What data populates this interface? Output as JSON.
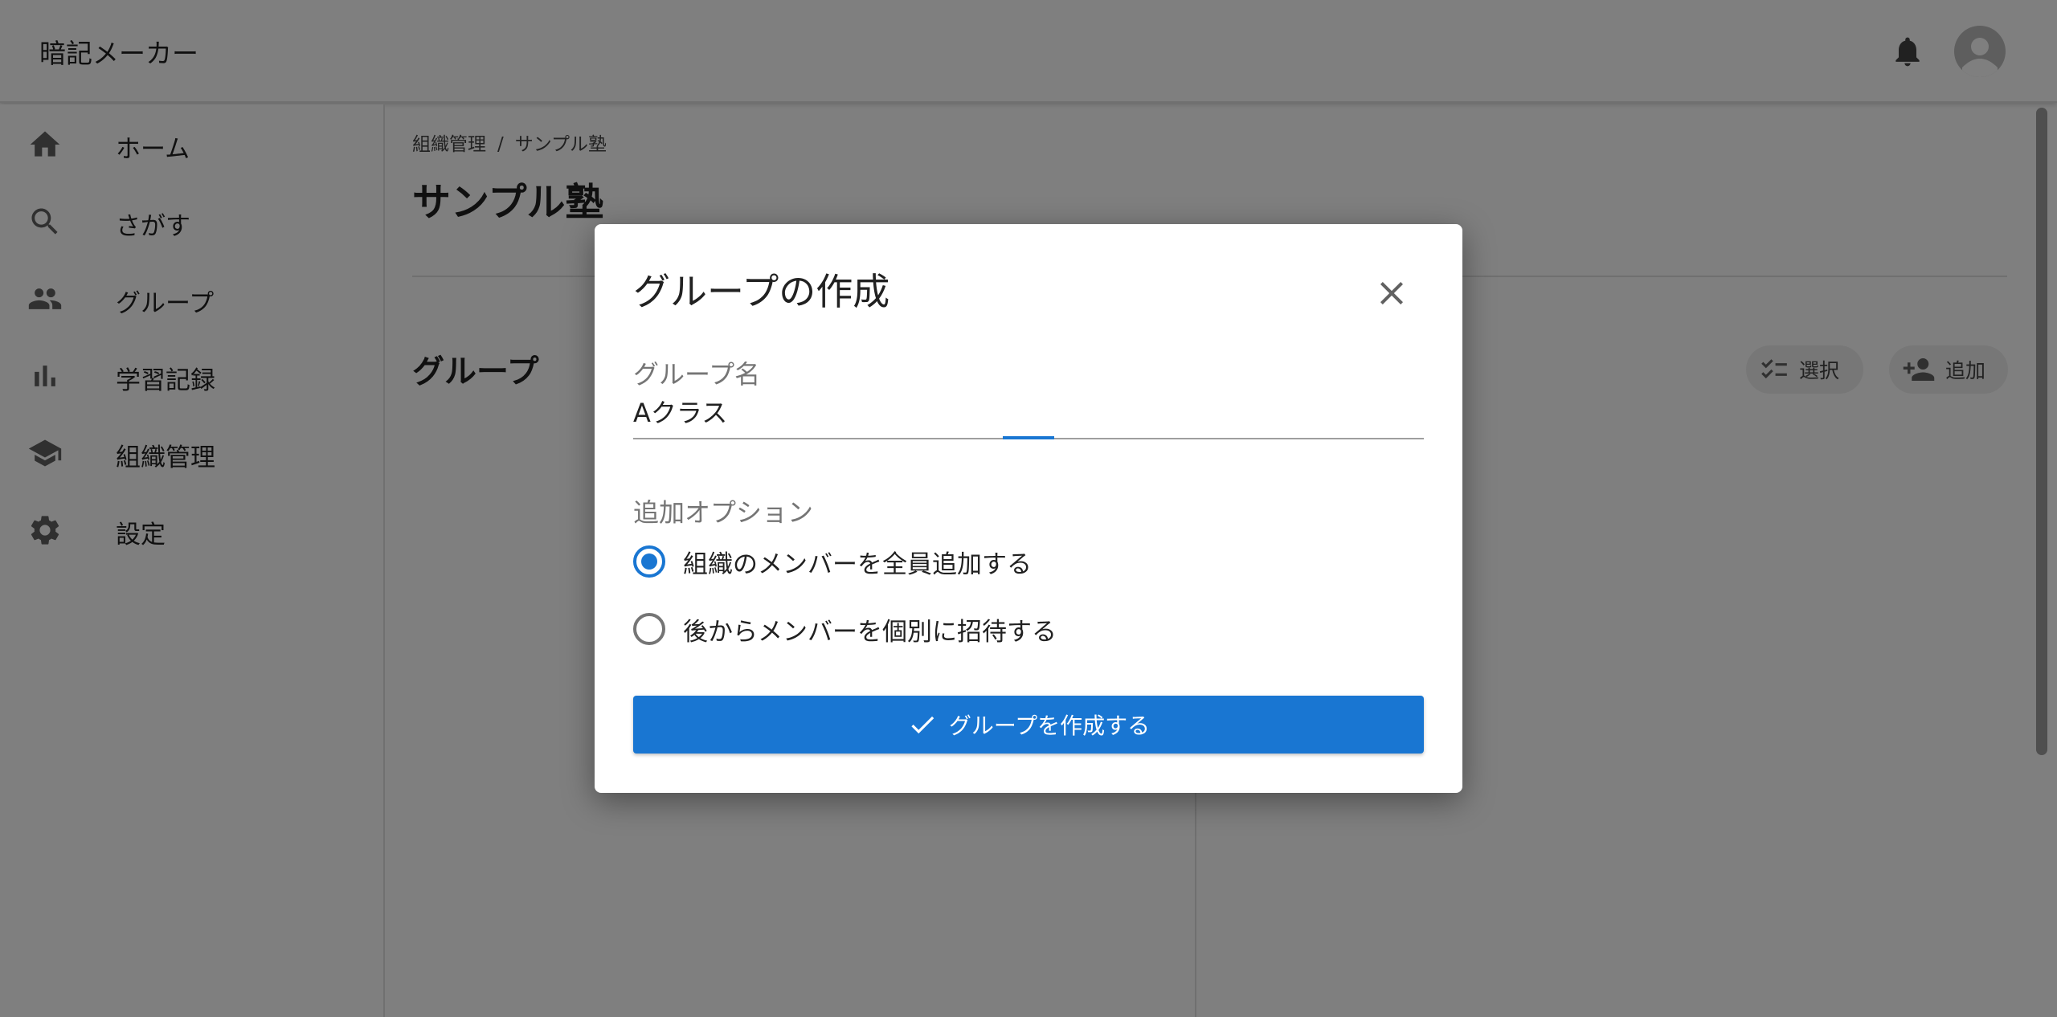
{
  "header": {
    "app_title": "暗記メーカー",
    "icons": [
      "bell-icon",
      "account-icon"
    ]
  },
  "sidebar": {
    "items": [
      {
        "label": "ホーム",
        "icon": "home-icon"
      },
      {
        "label": "さがす",
        "icon": "search-icon"
      },
      {
        "label": "グループ",
        "icon": "group-icon"
      },
      {
        "label": "学習記録",
        "icon": "bar-chart-icon"
      },
      {
        "label": "組織管理",
        "icon": "school-icon"
      },
      {
        "label": "設定",
        "icon": "gear-icon"
      }
    ]
  },
  "main": {
    "breadcrumb": {
      "parent": "組織管理",
      "separator": "/",
      "current": "サンプル塾"
    },
    "title": "サンプル塾",
    "section_title": "グループ",
    "actions": {
      "select_label": "選択",
      "add_label": "追加"
    }
  },
  "dialog": {
    "title": "グループの作成",
    "group_name_label": "グループ名",
    "group_name_value": "Aクラス",
    "options_label": "追加オプション",
    "options": [
      {
        "label": "組織のメンバーを全員追加する",
        "selected": true
      },
      {
        "label": "後からメンバーを個別に招待する",
        "selected": false
      }
    ],
    "submit_label": "グループを作成する"
  },
  "colors": {
    "primary": "#1976d2",
    "overlay": "rgba(0,0,0,0.5)",
    "icon": "#616161"
  }
}
